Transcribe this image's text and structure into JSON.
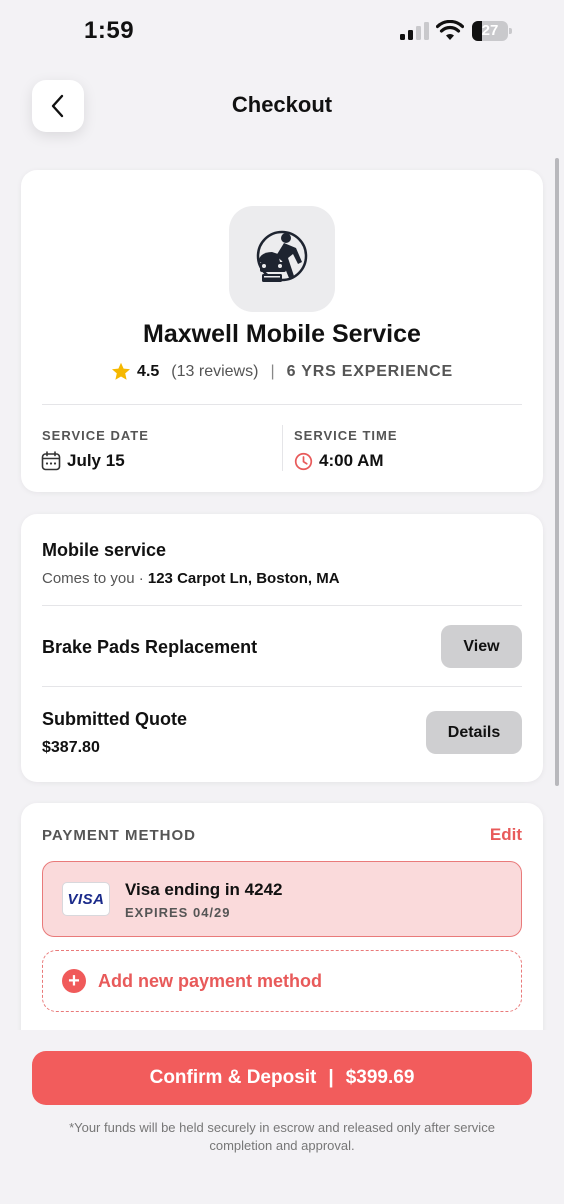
{
  "status_bar": {
    "time": "1:59",
    "battery": "27",
    "battery_level": 0.27
  },
  "header": {
    "title": "Checkout"
  },
  "business": {
    "name": "Maxwell Mobile Service",
    "rating": "4.5",
    "reviews": "(13 reviews)",
    "separator": "|",
    "experience": "6 YRS EXPERIENCE"
  },
  "schedule": {
    "date_label": "SERVICE DATE",
    "date_value": "July 15",
    "time_label": "SERVICE TIME",
    "time_value": "4:00 AM"
  },
  "service": {
    "type_title": "Mobile service",
    "type_sub": "Comes to you · ",
    "address": "123 Carpot Ln, Boston, MA",
    "item_title": "Brake Pads Replacement",
    "item_button": "View",
    "quote_title": "Submitted Quote",
    "quote_amount": "$387.80",
    "quote_button": "Details"
  },
  "payment": {
    "label": "PAYMENT METHOD",
    "edit": "Edit",
    "card_brand": "VISA",
    "card_name": "Visa ending in 4242",
    "card_expiry": "EXPIRES 04/29",
    "add_label": "Add new payment method"
  },
  "footer": {
    "confirm_label": "Confirm & Deposit",
    "confirm_sep": "|",
    "confirm_amount": "$399.69",
    "disclaimer": "*Your funds will be held securely in escrow and released only after service completion and approval."
  },
  "colors": {
    "accent": "#f25c5c",
    "selected_bg": "#fadadb",
    "star": "#f5b800"
  }
}
